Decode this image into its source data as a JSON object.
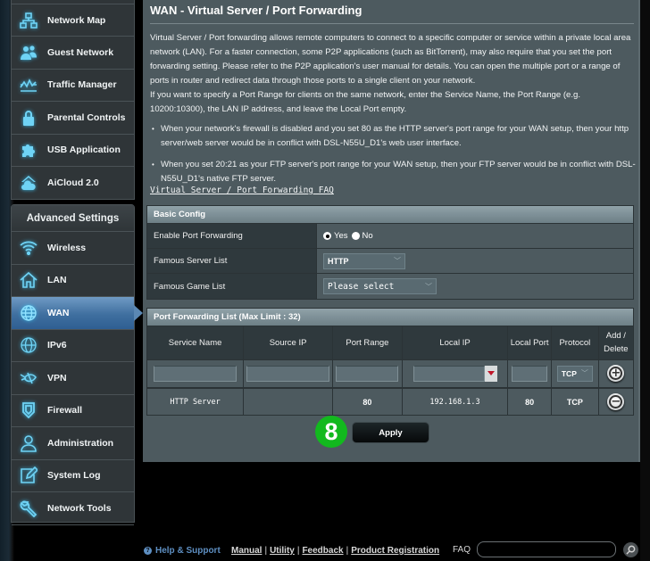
{
  "sidebar": {
    "general_items": [
      {
        "label": "Network Map",
        "icon": "network-map-icon"
      },
      {
        "label": "Guest Network",
        "icon": "guest-network-icon"
      },
      {
        "label": "Traffic Manager",
        "icon": "traffic-manager-icon"
      },
      {
        "label": "Parental Controls",
        "icon": "lock-icon"
      },
      {
        "label": "USB Application",
        "icon": "puzzle-icon"
      },
      {
        "label": "AiCloud 2.0",
        "icon": "cloud-icon"
      }
    ],
    "advanced_heading": "Advanced Settings",
    "advanced_items": [
      {
        "label": "Wireless",
        "icon": "wifi-icon"
      },
      {
        "label": "LAN",
        "icon": "house-icon"
      },
      {
        "label": "WAN",
        "icon": "globe-icon",
        "active": true
      },
      {
        "label": "IPv6",
        "icon": "ipv6-globe-icon"
      },
      {
        "label": "VPN",
        "icon": "vpn-icon"
      },
      {
        "label": "Firewall",
        "icon": "shield-icon"
      },
      {
        "label": "Administration",
        "icon": "user-icon"
      },
      {
        "label": "System Log",
        "icon": "edit-log-icon"
      },
      {
        "label": "Network Tools",
        "icon": "wrench-icon"
      }
    ]
  },
  "page": {
    "title": "WAN - Virtual Server / Port Forwarding",
    "description": "Virtual Server / Port forwarding allows remote computers to connect to a specific computer or service within a private local area network (LAN). For a faster connection, some P2P applications (such as BitTorrent), may also require that you set the port forwarding setting. Please refer to the P2P application's user manual for details. You can open the multiple port or a range of ports in router and redirect data through those ports to a single client on your network.",
    "description2": "If you want to specify a Port Range for clients on the same network, enter the Service Name, the Port Range (e.g. 10200:10300), the LAN IP address, and leave the Local Port empty.",
    "bullets": [
      "When your network's firewall is disabled and you set 80 as the HTTP server's port range for your WAN setup, then your http server/web server would be in conflict with DSL-N55U_D1's web user interface.",
      "When you set 20:21 as your FTP server's port range for your WAN setup, then your FTP server would be in conflict with DSL-N55U_D1's native FTP server."
    ],
    "faq_link": "Virtual Server / Port Forwarding FAQ"
  },
  "basic_config": {
    "heading": "Basic Config",
    "enable_label": "Enable Port Forwarding",
    "enable_yes": "Yes",
    "enable_no": "No",
    "enable_value": "Yes",
    "server_list_label": "Famous Server List",
    "server_list_value": "HTTP",
    "game_list_label": "Famous Game List",
    "game_list_value": "Please select"
  },
  "pf_list": {
    "heading": "Port Forwarding List (Max Limit : 32)",
    "columns": [
      "Service Name",
      "Source IP",
      "Port Range",
      "Local IP",
      "Local Port",
      "Protocol",
      "Add / Delete"
    ],
    "new_row": {
      "service_name": "",
      "source_ip": "",
      "port_range": "",
      "local_ip": "",
      "local_port": "",
      "protocol": "TCP"
    },
    "rows": [
      {
        "service_name": "HTTP Server",
        "source_ip": "",
        "port_range": "80",
        "local_ip": "192.168.1.3",
        "local_port": "80",
        "protocol": "TCP"
      }
    ]
  },
  "apply_label": "Apply",
  "step_badge": "8",
  "footer": {
    "help": "Help & Support",
    "links": [
      "Manual",
      "Utility",
      "Feedback",
      "Product Registration"
    ],
    "faq_label": "FAQ",
    "faq_input": ""
  }
}
